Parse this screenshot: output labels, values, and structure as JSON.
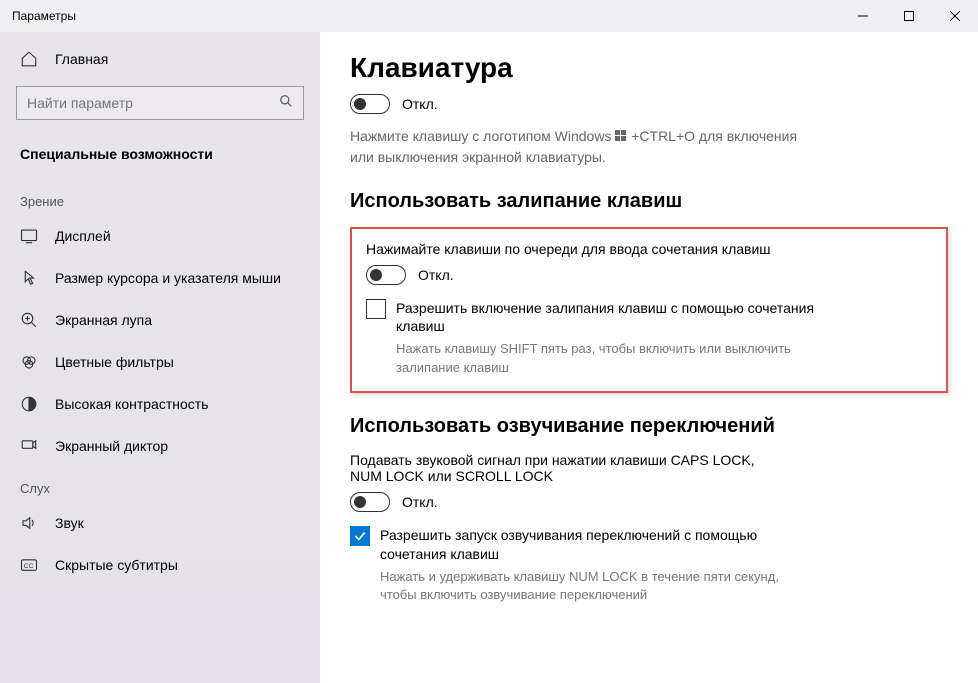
{
  "window": {
    "title": "Параметры"
  },
  "sidebar": {
    "home": "Главная",
    "search_placeholder": "Найти параметр",
    "category": "Специальные возможности",
    "groups": [
      {
        "label": "Зрение",
        "items": [
          {
            "icon": "display",
            "label": "Дисплей"
          },
          {
            "icon": "cursor",
            "label": "Размер курсора и указателя мыши"
          },
          {
            "icon": "magnifier",
            "label": "Экранная лупа"
          },
          {
            "icon": "colorfilter",
            "label": "Цветные фильтры"
          },
          {
            "icon": "contrast",
            "label": "Высокая контрастность"
          },
          {
            "icon": "narrator",
            "label": "Экранный диктор"
          }
        ]
      },
      {
        "label": "Слух",
        "items": [
          {
            "icon": "audio",
            "label": "Звук"
          },
          {
            "icon": "cc",
            "label": "Скрытые субтитры"
          }
        ]
      }
    ]
  },
  "content": {
    "title": "Клавиатура",
    "toggle1_state": "Откл.",
    "toggle1_desc_a": "Нажмите клавишу с логотипом Windows",
    "toggle1_desc_b": "+CTRL+O для включения или выключения экранной клавиатуры.",
    "section_sticky": "Использовать залипание клавиш",
    "sticky_desc": "Нажимайте клавиши по очереди для ввода сочетания клавиш",
    "sticky_toggle_state": "Откл.",
    "sticky_check_label": "Разрешить включение залипания клавиш с помощью сочетания клавиш",
    "sticky_check_desc": "Нажать клавишу SHIFT пять раз, чтобы включить или выключить залипание клавиш",
    "section_toggle": "Использовать озвучивание переключений",
    "togkeys_desc": "Подавать звуковой сигнал при нажатии клавиши CAPS LOCK, NUM LOCK или SCROLL LOCK",
    "togkeys_state": "Откл.",
    "togkeys_check_label": "Разрешить запуск озвучивания переключений с помощью сочетания клавиш",
    "togkeys_check_desc": "Нажать и удерживать клавишу NUM LOCK в течение пяти секунд, чтобы включить озвучивание переключений"
  }
}
